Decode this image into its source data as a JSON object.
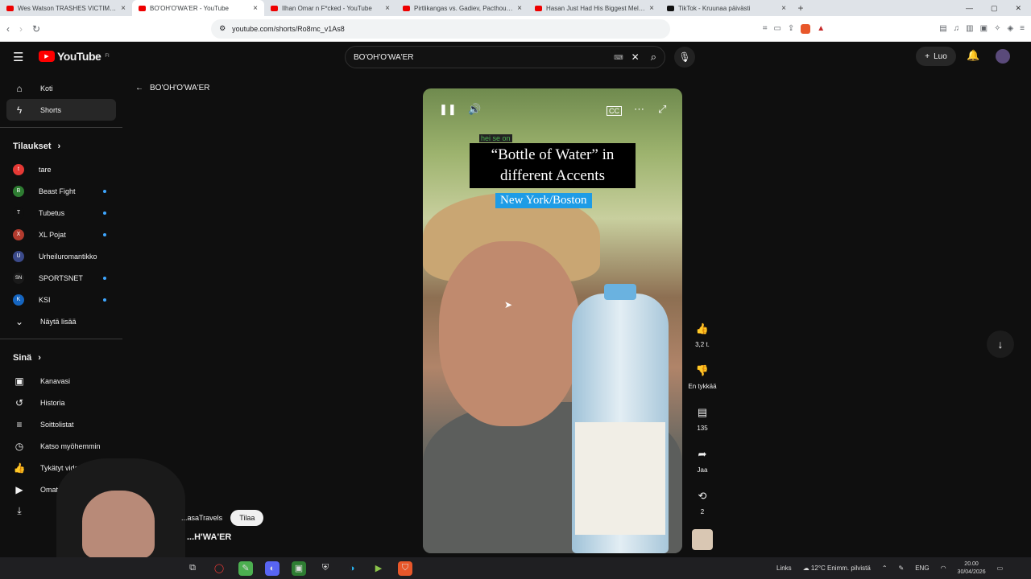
{
  "browser": {
    "tabs": [
      {
        "title": "Wes Watson TRASHES VICTIM & The",
        "favicon": "youtube-icon",
        "active": false
      },
      {
        "title": "BO'OH'O'WA'ER - YouTube",
        "favicon": "youtube-icon",
        "active": true
      },
      {
        "title": "Ilhan Omar n F*cked - YouTube",
        "favicon": "youtube-icon",
        "active": false
      },
      {
        "title": "Pirtlikangas vs. Gadiev, Pacthouse ja",
        "favicon": "youtube-icon",
        "active": false
      },
      {
        "title": "Hasan Just Had His Biggest Meltdown",
        "favicon": "youtube-icon",
        "active": false
      },
      {
        "title": "TikTok - Kruunaa päivästi",
        "favicon": "tiktok-icon",
        "active": false
      }
    ],
    "url": "youtube.com/shorts/Ro8mc_v1As8"
  },
  "header": {
    "logo_text": "YouTube",
    "region": "FI",
    "search_query": "BO'OH'O'WA'ER",
    "create_label": "Luo"
  },
  "sidebar": {
    "main": [
      {
        "label": "Koti",
        "icon": "home-icon"
      },
      {
        "label": "Shorts",
        "icon": "shorts-icon",
        "active": true
      }
    ],
    "subs_heading": "Tilaukset",
    "subs": [
      {
        "label": "tare",
        "initial": "t",
        "color": "#e53935",
        "dot": false
      },
      {
        "label": "Beast Fight",
        "initial": "B",
        "color": "#2e7d32",
        "dot": true
      },
      {
        "label": "Tubetus",
        "initial": "T",
        "color": "#0f0f0f",
        "dot": true
      },
      {
        "label": "XL Pojat",
        "initial": "X",
        "color": "#b23b2e",
        "dot": true
      },
      {
        "label": "Urheiluromantikko",
        "initial": "U",
        "color": "#3b4a8a",
        "dot": true
      },
      {
        "label": "SPORTSNET",
        "initial": "SN",
        "color": "#1a1a1a",
        "dot": true
      },
      {
        "label": "KSI",
        "initial": "K",
        "color": "#1565c0",
        "dot": true
      }
    ],
    "show_more": "Näytä lisää",
    "you_heading": "Sinä",
    "you": [
      {
        "label": "Kanavasi",
        "icon": "channel-icon"
      },
      {
        "label": "Historia",
        "icon": "history-icon"
      },
      {
        "label": "Soittolistat",
        "icon": "playlists-icon"
      },
      {
        "label": "Katso myöhemmin",
        "icon": "watch-later-icon"
      },
      {
        "label": "Tykätyt videot",
        "icon": "liked-icon"
      },
      {
        "label": "Omat videot",
        "icon": "my-videos-icon"
      }
    ]
  },
  "shorts": {
    "back_label": "BO'OH'O'WA'ER",
    "caption_small": "hei se on",
    "caption_title": "“Bottle of Water” in different Accents",
    "caption_accent": "New York/Boston",
    "likes": "3,2 t.",
    "dislike_label": "En tykkää",
    "comments": "135",
    "share_label": "Jaa",
    "remix_count": "2",
    "channel_name": "...asaTravels",
    "subscribe_label": "Tilaa",
    "video_title": "...H'WA'ER"
  },
  "taskbar": {
    "links_label": "Links",
    "weather": "12°C  Enimm. pilvistä",
    "lang": "ENG",
    "time": "20.00",
    "date": "30/04/2026"
  }
}
